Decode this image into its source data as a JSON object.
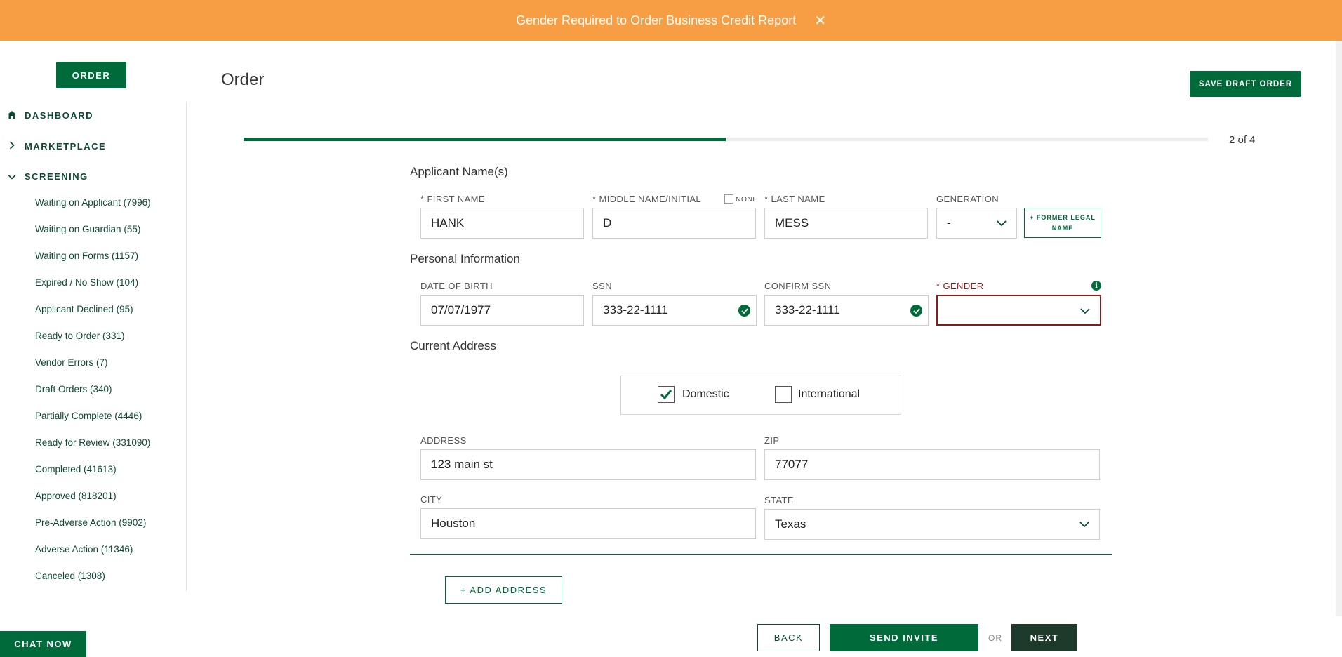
{
  "banner": {
    "message": "Gender Required to Order Business Credit Report",
    "close_glyph": "✕"
  },
  "sidebar": {
    "order_label": "ORDER",
    "top_items": [
      {
        "label": "DASHBOARD",
        "icon": "home-icon"
      },
      {
        "label": "MARKETPLACE",
        "icon": "chevron-right-icon"
      },
      {
        "label": "SCREENING",
        "icon": "chevron-down-icon"
      }
    ],
    "screening_items": [
      "Waiting on Applicant (7996)",
      "Waiting on Guardian (55)",
      "Waiting on Forms (1157)",
      "Expired / No Show (104)",
      "Applicant Declined (95)",
      "Ready to Order (331)",
      "Vendor Errors (7)",
      "Draft Orders (340)",
      "Partially Complete (4446)",
      "Ready for Review (331090)",
      "Completed (41613)",
      "Approved (818201)",
      "Pre-Adverse Action (9902)",
      "Adverse Action (11346)",
      "Canceled (1308)"
    ],
    "chat_label": "CHAT NOW"
  },
  "header": {
    "title": "Order",
    "save_draft_label": "SAVE DRAFT ORDER"
  },
  "progress": {
    "text": "2 of 4",
    "fraction": 0.5
  },
  "applicant": {
    "section_title": "Applicant Name(s)",
    "first_name_label": "* FIRST NAME",
    "first_name": "HANK",
    "middle_label": "* MIDDLE NAME/INITIAL",
    "none_label": "NONE",
    "middle": "D",
    "last_name_label": "* LAST NAME",
    "last_name": "MESS",
    "generation_label": "GENERATION",
    "generation": "-",
    "former_name_label": "+ FORMER LEGAL NAME"
  },
  "personal": {
    "section_title": "Personal Information",
    "dob_label": "DATE OF BIRTH",
    "dob": "07/07/1977",
    "ssn_label": "SSN",
    "ssn": "333-22-1111",
    "confirm_ssn_label": "CONFIRM SSN",
    "confirm_ssn": "333-22-1111",
    "gender_label": "* GENDER",
    "gender": ""
  },
  "address": {
    "section_title": "Current Address",
    "domestic_label": "Domestic",
    "international_label": "International",
    "domestic_checked": true,
    "address_label": "ADDRESS",
    "address": "123 main st",
    "zip_label": "ZIP",
    "zip": "77077",
    "city_label": "CITY",
    "city": "Houston",
    "state_label": "STATE",
    "state": "Texas",
    "add_address_label": "+ ADD ADDRESS"
  },
  "footer": {
    "back_label": "BACK",
    "send_invite_label": "SEND INVITE",
    "or_label": "OR",
    "next_label": "NEXT"
  },
  "colors": {
    "brand_green": "#006b3a",
    "banner_orange": "#f79d43",
    "error_red": "#8b1a1a",
    "dark_green": "#1d3a2b"
  }
}
